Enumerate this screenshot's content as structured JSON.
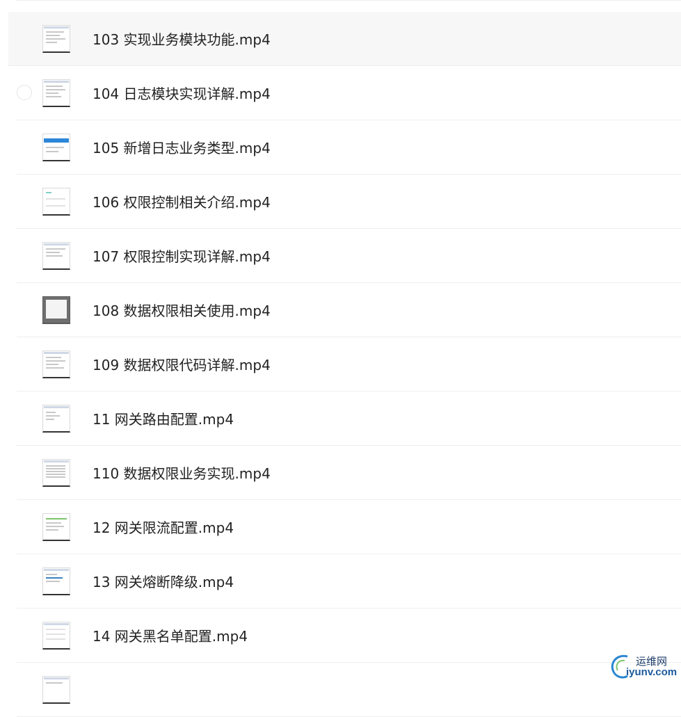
{
  "files": [
    {
      "name": "103 实现业务模块功能.mp4",
      "thumb": "code"
    },
    {
      "name": "104 日志模块实现详解.mp4",
      "thumb": "code"
    },
    {
      "name": "105 新增日志业务类型.mp4",
      "thumb": "blue"
    },
    {
      "name": "106 权限控制相关介绍.mp4",
      "thumb": "light"
    },
    {
      "name": "107 权限控制实现详解.mp4",
      "thumb": "code"
    },
    {
      "name": "108 数据权限相关使用.mp4",
      "thumb": "gray"
    },
    {
      "name": "109 数据权限代码详解.mp4",
      "thumb": "code"
    },
    {
      "name": "11 网关路由配置.mp4",
      "thumb": "code"
    },
    {
      "name": "110 数据权限业务实现.mp4",
      "thumb": "table"
    },
    {
      "name": "12 网关限流配置.mp4",
      "thumb": "green"
    },
    {
      "name": "13 网关熔断降级.mp4",
      "thumb": "code"
    },
    {
      "name": "14 网关黑名单配置.mp4",
      "thumb": "light"
    },
    {
      "name": "",
      "thumb": "code"
    }
  ],
  "watermark": {
    "cn": "运维网",
    "en": "iyunv.com"
  }
}
